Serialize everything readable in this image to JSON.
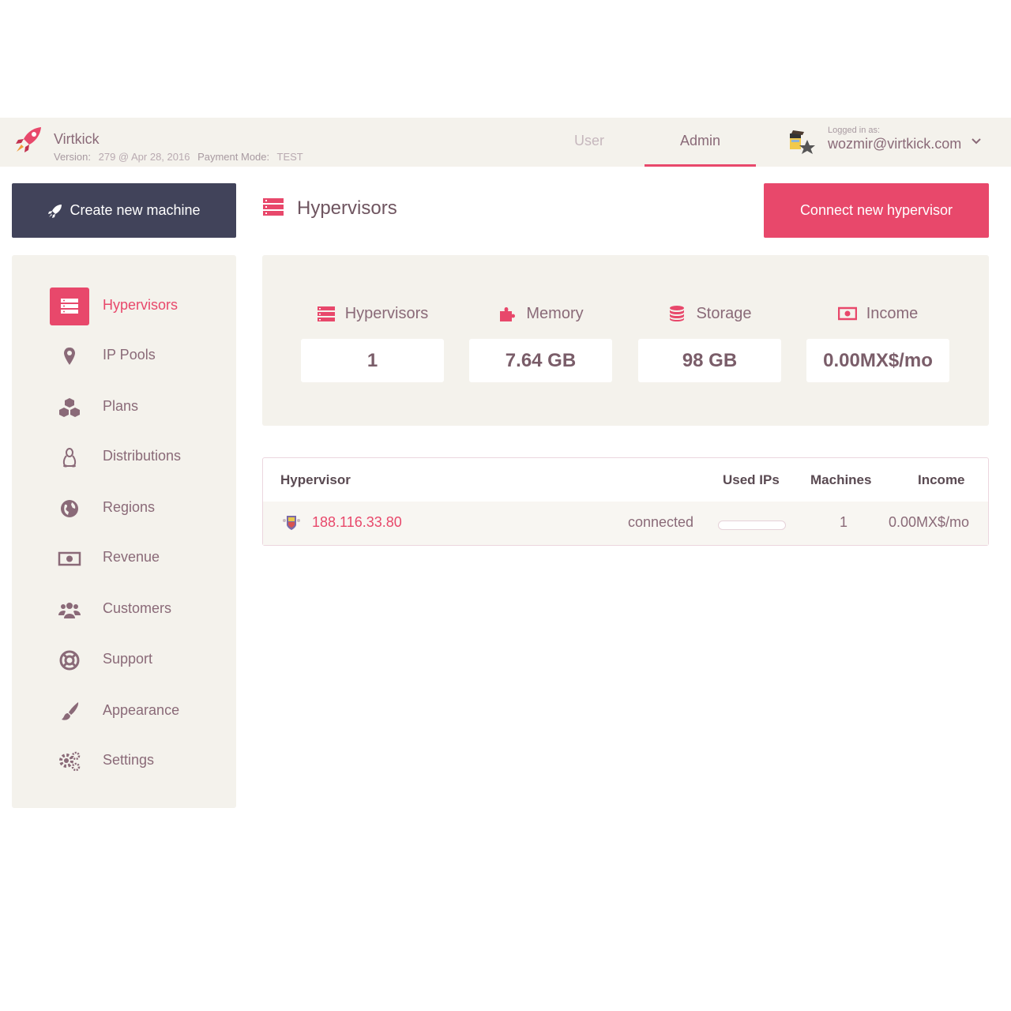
{
  "header": {
    "brand_name": "Virtkick",
    "version_label": "Version:",
    "version_value": "279 @ Apr 28, 2016",
    "payment_label": "Payment Mode:",
    "payment_value": "TEST",
    "tabs": [
      {
        "label": "User",
        "active": false
      },
      {
        "label": "Admin",
        "active": true
      }
    ],
    "logged_in_label": "Logged in as:",
    "logged_in_email": "wozmir@virtkick.com"
  },
  "create_button": {
    "label": "Create new machine",
    "icon": "rocket-icon"
  },
  "sidebar": {
    "items": [
      {
        "label": "Hypervisors",
        "icon": "server-icon",
        "active": true
      },
      {
        "label": "IP Pools",
        "icon": "map-marker-icon",
        "active": false
      },
      {
        "label": "Plans",
        "icon": "cubes-icon",
        "active": false
      },
      {
        "label": "Distributions",
        "icon": "linux-icon",
        "active": false
      },
      {
        "label": "Regions",
        "icon": "globe-icon",
        "active": false
      },
      {
        "label": "Revenue",
        "icon": "money-icon",
        "active": false
      },
      {
        "label": "Customers",
        "icon": "users-icon",
        "active": false
      },
      {
        "label": "Support",
        "icon": "life-ring-icon",
        "active": false
      },
      {
        "label": "Appearance",
        "icon": "paint-brush-icon",
        "active": false
      },
      {
        "label": "Settings",
        "icon": "cogs-icon",
        "active": false
      }
    ]
  },
  "page": {
    "title": "Hypervisors",
    "icon": "server-icon",
    "connect_button": "Connect new hypervisor"
  },
  "stats": [
    {
      "label": "Hypervisors",
      "value": "1",
      "icon": "server-icon"
    },
    {
      "label": "Memory",
      "value": "7.64 GB",
      "icon": "puzzle-icon"
    },
    {
      "label": "Storage",
      "value": "98 GB",
      "icon": "database-icon"
    },
    {
      "label": "Income",
      "value": "0.00MX$/mo",
      "icon": "money-icon"
    }
  ],
  "table": {
    "columns": [
      "Hypervisor",
      "Used IPs",
      "Machines",
      "Income"
    ],
    "rows": [
      {
        "host": "188.116.33.80",
        "status": "connected",
        "used_ips_fraction": 0,
        "machines": "1",
        "income": "0.00MX$/mo"
      }
    ]
  },
  "colors": {
    "accent": "#e8486b",
    "dark_button": "#41435a",
    "panel": "#f4f2ec",
    "text": "#8a6a78"
  }
}
